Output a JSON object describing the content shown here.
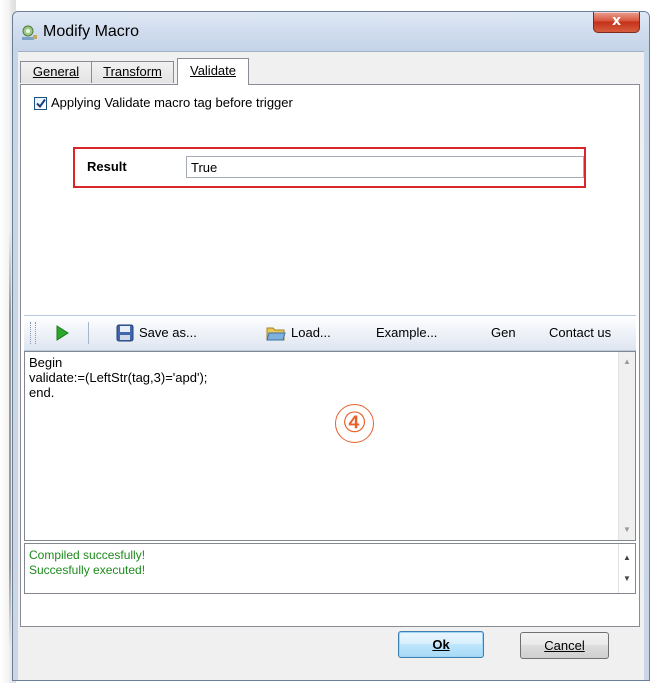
{
  "window": {
    "title": "Modify Macro",
    "close_glyph": "x"
  },
  "tabs": [
    {
      "label": "General",
      "active": false
    },
    {
      "label": "Transform",
      "active": false
    },
    {
      "label": "Validate",
      "active": true
    }
  ],
  "validate": {
    "checkbox_checked": true,
    "checkbox_label": "Applying Validate macro tag before trigger",
    "result_label": "Result",
    "result_value": "True",
    "highlight_color": "#d9262b"
  },
  "toolbar": {
    "save_as": "Save as...",
    "load": "Load...",
    "example": "Example...",
    "gen": "Gen",
    "contact": "Contact us"
  },
  "editor": {
    "code": "Begin\nvalidate:=(LeftStr(tag,3)='apd');\nend.",
    "step_marker": "④"
  },
  "messages": [
    "Compiled succesfully!",
    "Succesfully executed!"
  ],
  "buttons": {
    "ok": "Ok",
    "cancel": "Cancel"
  },
  "colors": {
    "message_text": "#1d8a1d",
    "marker": "#e8602c",
    "run_icon": "#2aa82a"
  }
}
